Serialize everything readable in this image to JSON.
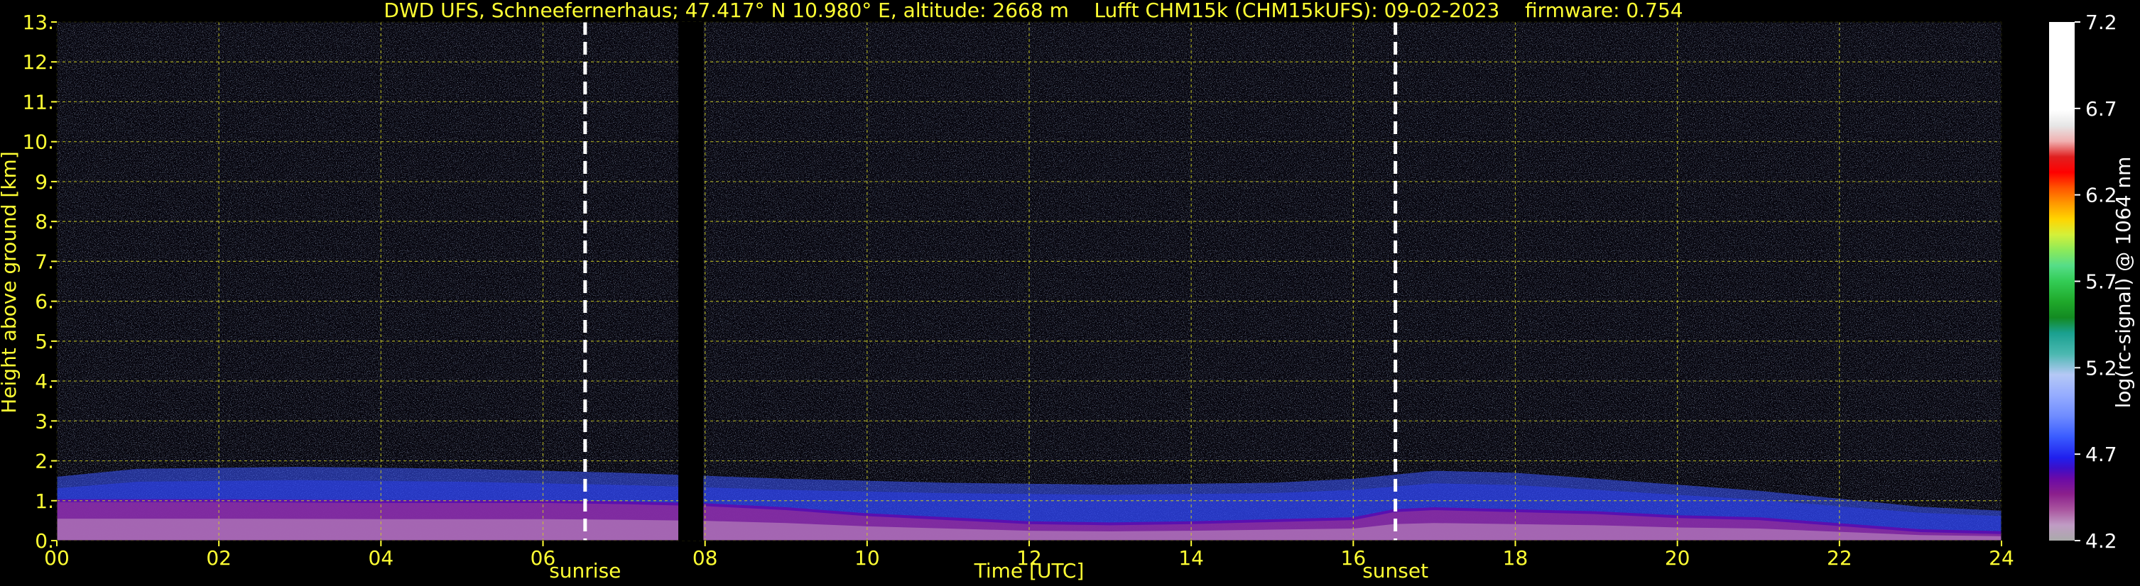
{
  "colors": {
    "background": "#000000",
    "text_accent": "#ffff33",
    "grid": "#cccc22",
    "colorbar_text": "#ffffff"
  },
  "chart_data": {
    "type": "heatmap",
    "title": "DWD UFS, Schneefernerhaus; 47.417° N 10.980° E, altitude: 2668 m    Lufft CHM15k (CHM15kUFS): 09-02-2023    firmware: 0.754",
    "xlabel": "Time [UTC]",
    "ylabel": "Height above ground [km]",
    "xlim": [
      0,
      24
    ],
    "ylim": [
      0,
      13
    ],
    "x_tick_labels": [
      "00",
      "02",
      "04",
      "06",
      "08",
      "10",
      "12",
      "14",
      "16",
      "18",
      "20",
      "22",
      "24"
    ],
    "y_tick_labels": [
      "0.",
      "1.",
      "2.",
      "3.",
      "4.",
      "5.",
      "6.",
      "7.",
      "8.",
      "9.",
      "10.",
      "11.",
      "12.",
      "13."
    ],
    "grid": true,
    "annotations": [
      {
        "label": "sunrise",
        "x": 6.52
      },
      {
        "label": "sunset",
        "x": 16.52
      }
    ],
    "data_gap": [
      7.67,
      7.98
    ],
    "colorbar": {
      "label": "log(rc-signal) @ 1064 nm",
      "range": [
        4.2,
        7.2
      ],
      "tick_labels": [
        "4.2",
        "4.7",
        "5.2",
        "5.7",
        "6.2",
        "6.7",
        "7.2"
      ]
    },
    "layers": {
      "boundary_layer_top_km": [
        [
          0,
          1.0
        ],
        [
          2,
          1.0
        ],
        [
          4,
          0.98
        ],
        [
          6,
          0.98
        ],
        [
          7,
          0.95
        ],
        [
          8,
          0.9
        ],
        [
          9,
          0.8
        ],
        [
          10,
          0.65
        ],
        [
          11,
          0.55
        ],
        [
          12,
          0.45
        ],
        [
          13,
          0.42
        ],
        [
          14,
          0.45
        ],
        [
          15,
          0.5
        ],
        [
          16,
          0.55
        ],
        [
          16.5,
          0.75
        ],
        [
          17,
          0.8
        ],
        [
          18,
          0.75
        ],
        [
          19,
          0.7
        ],
        [
          20,
          0.6
        ],
        [
          21,
          0.55
        ],
        [
          22,
          0.4
        ],
        [
          23,
          0.25
        ],
        [
          24,
          0.2
        ]
      ],
      "aerosol_layer_top_km": [
        [
          0,
          1.6
        ],
        [
          1,
          1.8
        ],
        [
          3,
          1.85
        ],
        [
          5,
          1.8
        ],
        [
          7,
          1.7
        ],
        [
          9,
          1.55
        ],
        [
          11,
          1.45
        ],
        [
          13,
          1.4
        ],
        [
          15,
          1.45
        ],
        [
          16,
          1.55
        ],
        [
          17,
          1.75
        ],
        [
          18,
          1.7
        ],
        [
          19,
          1.55
        ],
        [
          20,
          1.4
        ],
        [
          21,
          1.25
        ],
        [
          22,
          1.05
        ],
        [
          23,
          0.85
        ],
        [
          24,
          0.75
        ]
      ]
    }
  }
}
